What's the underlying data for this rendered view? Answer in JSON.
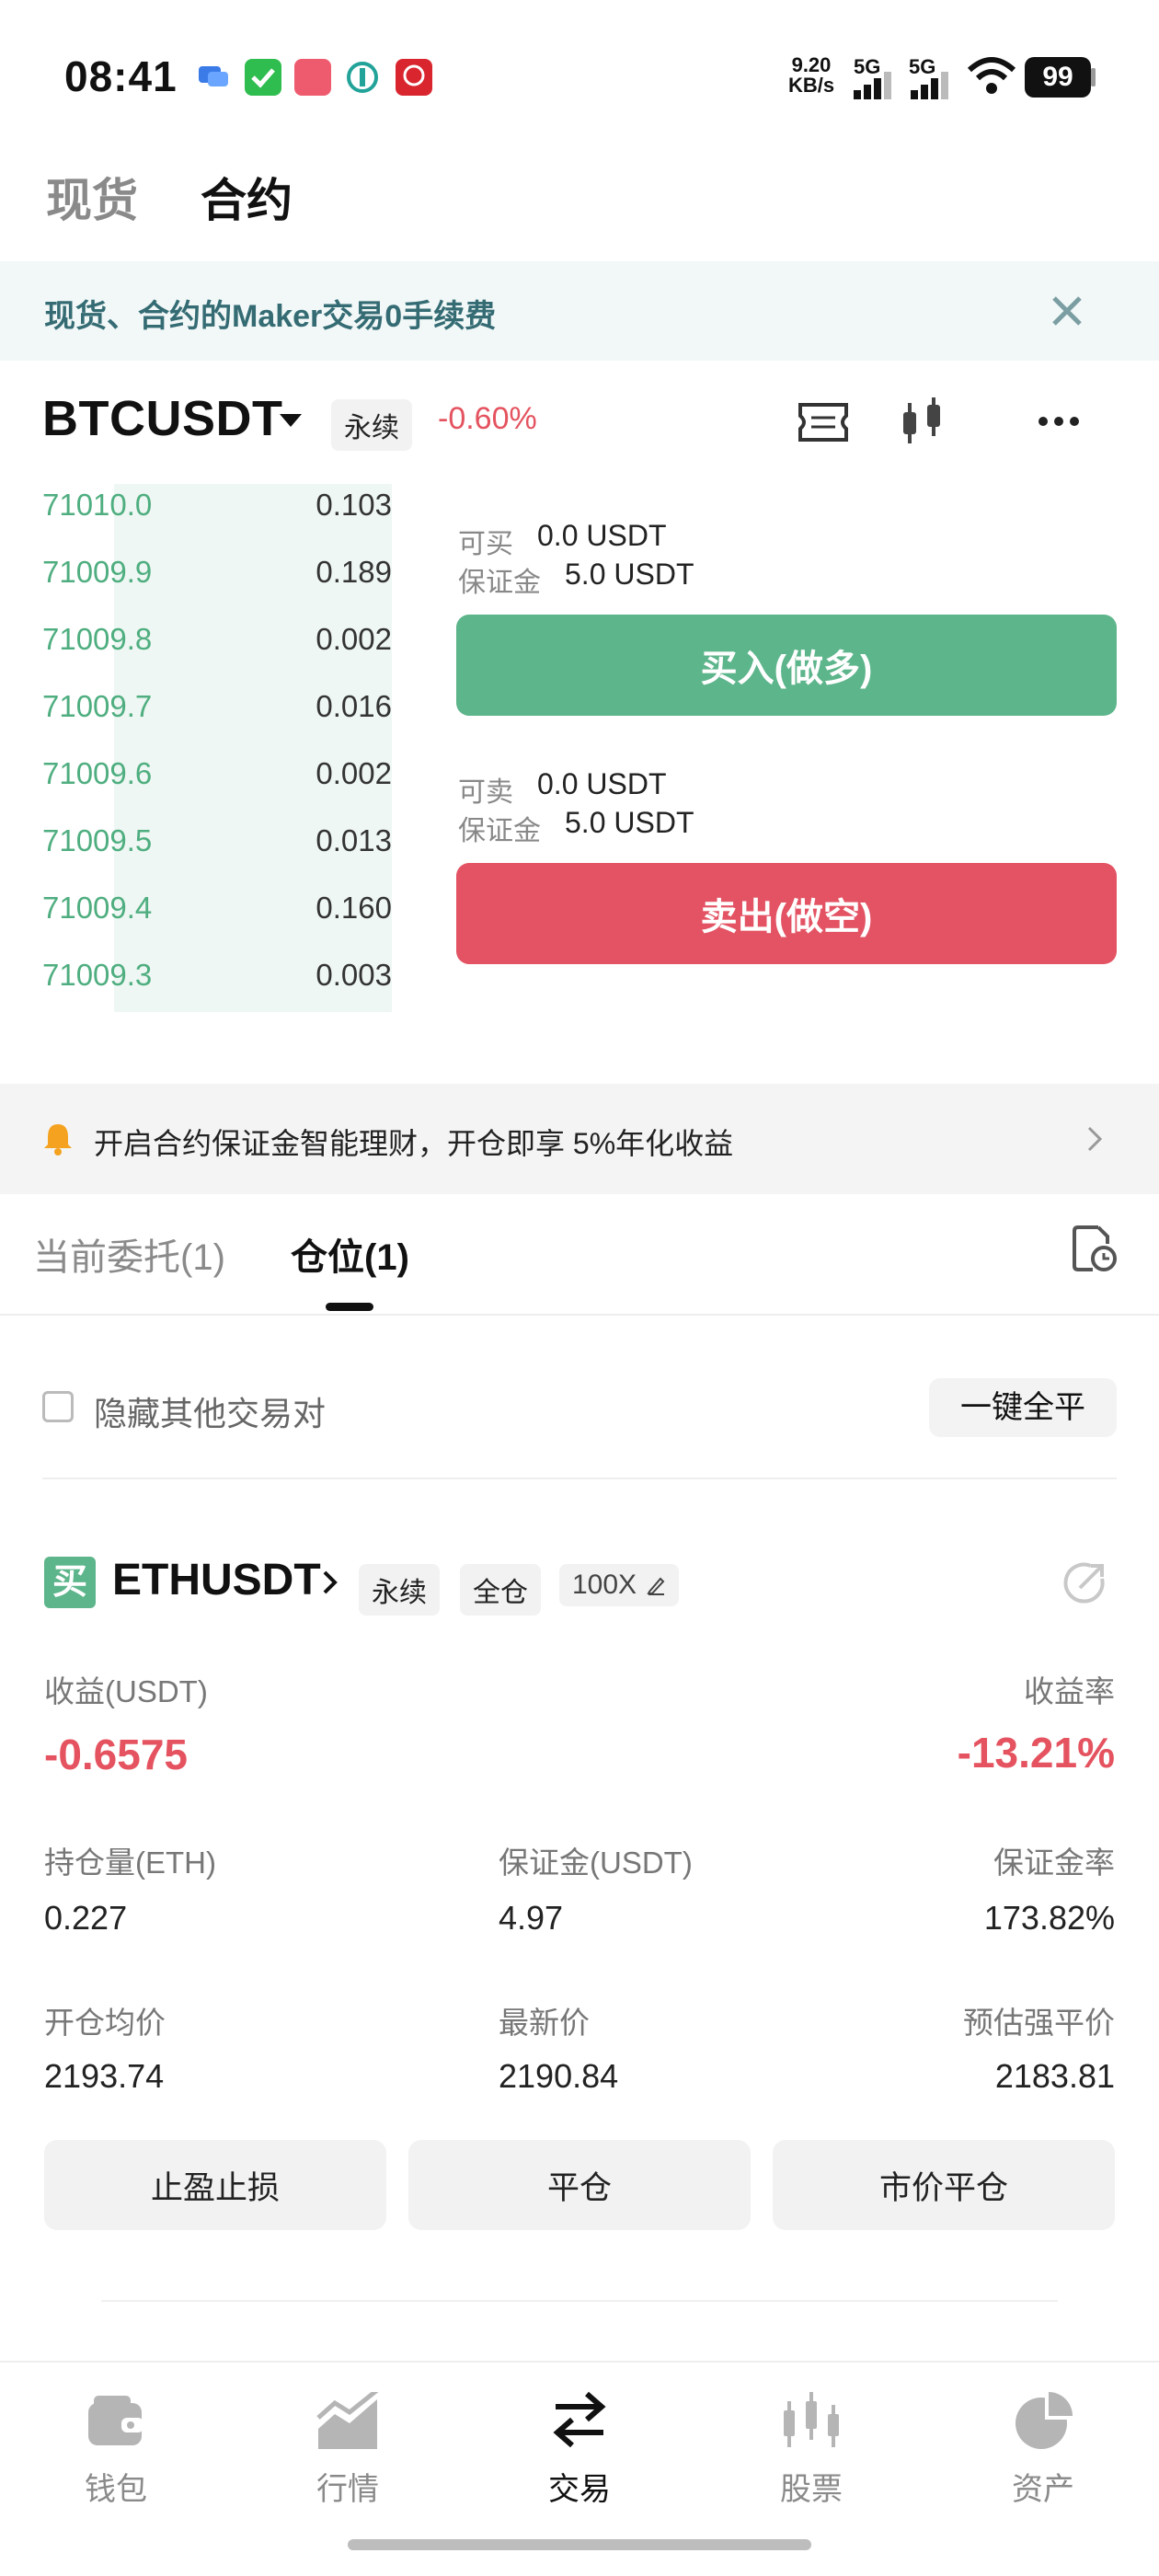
{
  "status_bar": {
    "time": "08:41",
    "net_speed_value": "9.20",
    "net_speed_unit": "KB/s",
    "signal1": "5G",
    "signal2": "5G",
    "battery": "99"
  },
  "top_tabs": [
    {
      "label": "现货",
      "active": false
    },
    {
      "label": "合约",
      "active": true
    }
  ],
  "banner": {
    "text": "现货、合约的Maker交易0手续费"
  },
  "symbol": {
    "name": "BTCUSDT",
    "type_tag": "永续",
    "change": "-0.60%"
  },
  "orderbook": [
    {
      "price": "71010.0",
      "qty": "0.103"
    },
    {
      "price": "71009.9",
      "qty": "0.189"
    },
    {
      "price": "71009.8",
      "qty": "0.002"
    },
    {
      "price": "71009.7",
      "qty": "0.016"
    },
    {
      "price": "71009.6",
      "qty": "0.002"
    },
    {
      "price": "71009.5",
      "qty": "0.013"
    },
    {
      "price": "71009.4",
      "qty": "0.160"
    },
    {
      "price": "71009.3",
      "qty": "0.003"
    }
  ],
  "buy": {
    "available_label": "可买",
    "available_value": "0.0 USDT",
    "margin_label": "保证金",
    "margin_value": "5.0 USDT",
    "button": "买入(做多)"
  },
  "sell": {
    "available_label": "可卖",
    "available_value": "0.0 USDT",
    "margin_label": "保证金",
    "margin_value": "5.0 USDT",
    "button": "卖出(做空)"
  },
  "promo": {
    "text": "开启合约保证金智能理财，开仓即享 5%年化收益"
  },
  "position_tabs": [
    {
      "label": "当前委托(1)",
      "active": false
    },
    {
      "label": "仓位(1)",
      "active": true
    }
  ],
  "hide_other": {
    "label": "隐藏其他交易对"
  },
  "close_all_button": "一键全平",
  "position": {
    "side_badge": "买",
    "symbol": "ETHUSDT",
    "tag_perpetual": "永续",
    "tag_margin_mode": "全仓",
    "leverage": "100X",
    "pnl_label": "收益(USDT)",
    "pnl_value": "-0.6575",
    "roe_label": "收益率",
    "roe_value": "-13.21%",
    "size_label": "持仓量(ETH)",
    "size_value": "0.227",
    "margin_label": "保证金(USDT)",
    "margin_value": "4.97",
    "margin_ratio_label": "保证金率",
    "margin_ratio_value": "173.82%",
    "entry_label": "开仓均价",
    "entry_value": "2193.74",
    "mark_label": "最新价",
    "mark_value": "2190.84",
    "liq_label": "预估强平价",
    "liq_value": "2183.81",
    "actions": [
      "止盈止损",
      "平仓",
      "市价平仓"
    ]
  },
  "bottom_nav": [
    {
      "label": "钱包",
      "icon": "wallet-icon"
    },
    {
      "label": "行情",
      "icon": "market-chart-icon"
    },
    {
      "label": "交易",
      "icon": "swap-arrows-icon"
    },
    {
      "label": "股票",
      "icon": "candlestick-icon"
    },
    {
      "label": "资产",
      "icon": "pie-chart-icon"
    }
  ],
  "colors": {
    "buy": "#5db58b",
    "sell": "#e35363",
    "loss": "#e4535f",
    "banner_text": "#356c74"
  }
}
